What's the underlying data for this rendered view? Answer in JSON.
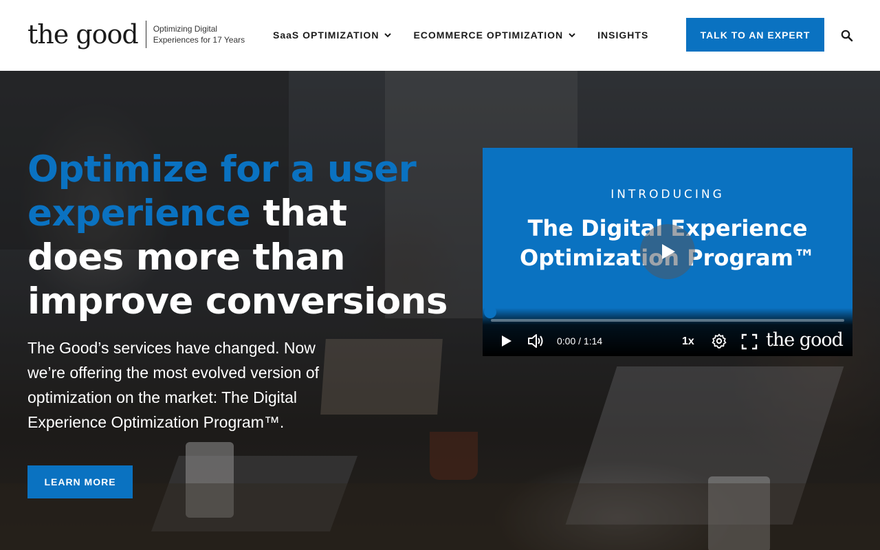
{
  "brand": {
    "logo_text": "the good",
    "tagline": "Optimizing Digital Experiences for 17 Years",
    "accent": "#0a72c1"
  },
  "nav": {
    "items": [
      {
        "label": "SaaS OPTIMIZATION",
        "has_dropdown": true
      },
      {
        "label": "ECOMMERCE OPTIMIZATION",
        "has_dropdown": true
      },
      {
        "label": "INSIGHTS",
        "has_dropdown": false
      }
    ],
    "cta_label": "TALK TO AN EXPERT",
    "search_icon": "search-icon"
  },
  "hero": {
    "headline_accent": "Optimize for a user experience",
    "headline_rest": " that does more than improve conversions",
    "subcopy": "The Good’s services have changed. Now we’re offering the most evolved version of optimization on the market: The Digital Experience Optimization Program™.",
    "button_label": "LEARN MORE"
  },
  "video": {
    "eyebrow": "INTRODUCING",
    "title": "The Digital Experience Optimization Program™",
    "current_time": "0:00",
    "duration": "1:14",
    "time_display": "0:00 / 1:14",
    "speed": "1x",
    "logo_text": "the good",
    "progress": 0
  }
}
